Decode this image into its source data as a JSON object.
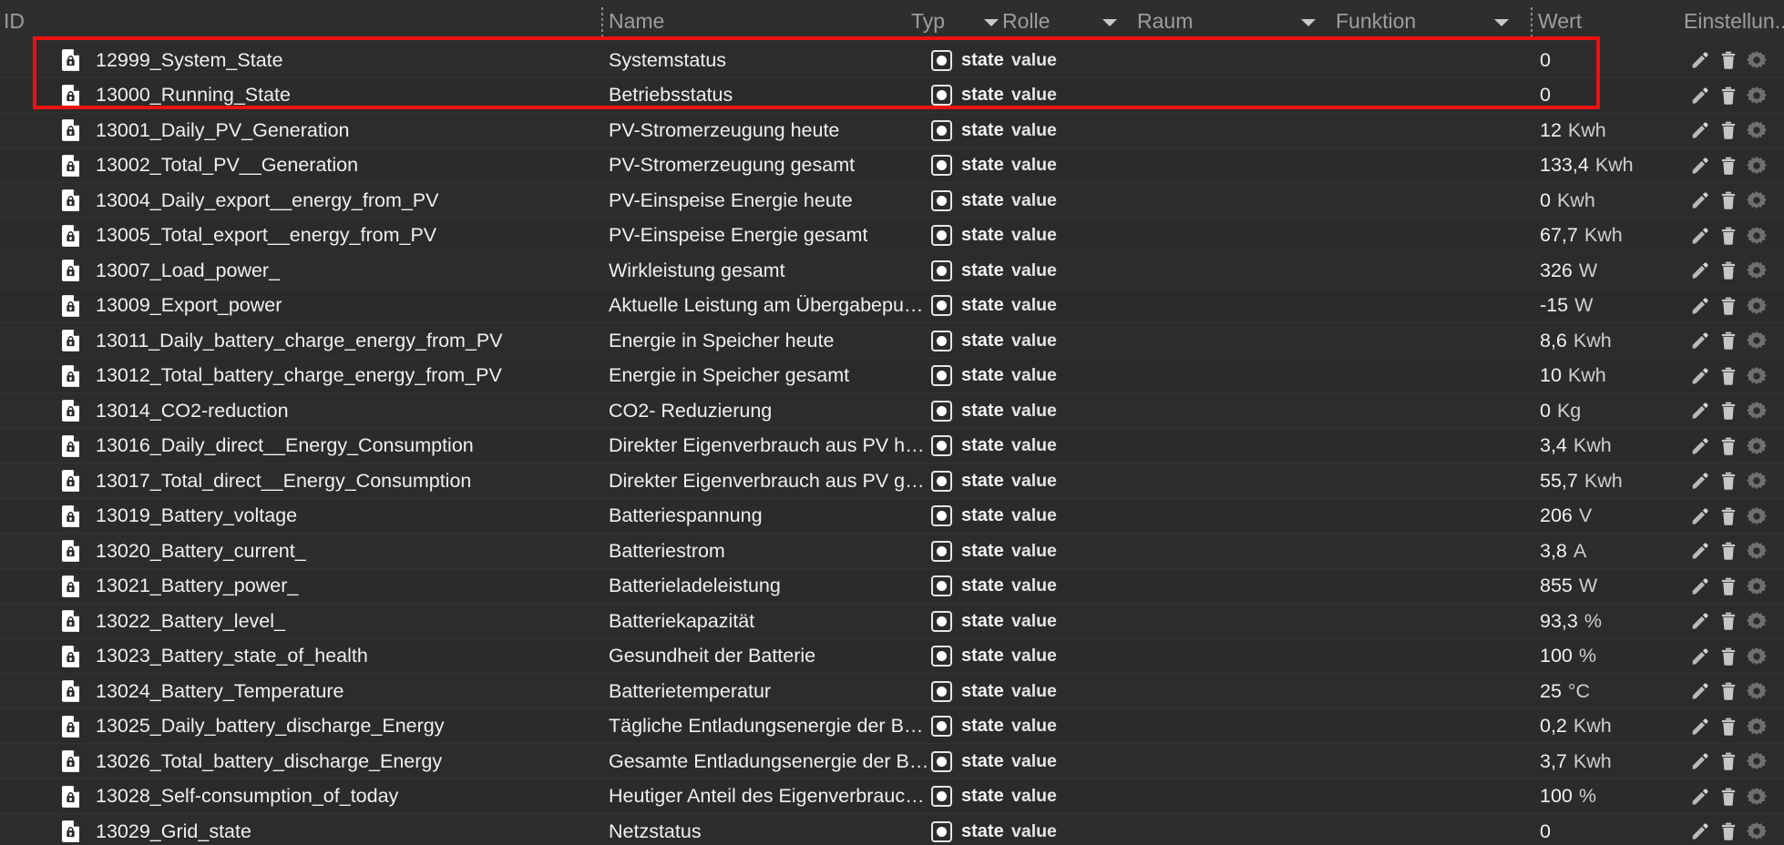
{
  "table": {
    "columns": [
      {
        "key": "id",
        "label": "ID",
        "has_filter": false,
        "has_caret": false
      },
      {
        "key": "name",
        "label": "Name",
        "has_filter": false,
        "has_caret": false
      },
      {
        "key": "typ",
        "label": "Typ",
        "has_filter": true,
        "has_caret": true
      },
      {
        "key": "rolle",
        "label": "Rolle",
        "has_filter": true,
        "has_caret": true
      },
      {
        "key": "raum",
        "label": "Raum",
        "has_filter": true,
        "has_caret": true
      },
      {
        "key": "funktion",
        "label": "Funktion",
        "has_filter": true,
        "has_caret": true
      },
      {
        "key": "wert",
        "label": "Wert",
        "has_filter": false,
        "has_caret": false
      },
      {
        "key": "settings",
        "label": "Einstellun...",
        "has_filter": true,
        "has_caret": false
      }
    ],
    "row_actions": [
      {
        "icon": "pencil-icon",
        "title": "Bearbeiten"
      },
      {
        "icon": "trash-icon",
        "title": "Löschen"
      },
      {
        "icon": "gear-icon",
        "title": "Einstellungen"
      }
    ],
    "rows": [
      {
        "id": "12999_System_State",
        "name": "Systemstatus",
        "typ": "state",
        "rolle": "value",
        "raum": "",
        "funktion": "",
        "wert_num": "0",
        "wert_unit": "",
        "highlighted": true
      },
      {
        "id": "13000_Running_State",
        "name": "Betriebsstatus",
        "typ": "state",
        "rolle": "value",
        "raum": "",
        "funktion": "",
        "wert_num": "0",
        "wert_unit": "",
        "highlighted": true
      },
      {
        "id": "13001_Daily_PV_Generation",
        "name": "PV-Stromerzeugung heute",
        "typ": "state",
        "rolle": "value",
        "raum": "",
        "funktion": "",
        "wert_num": "12",
        "wert_unit": "Kwh",
        "highlighted": false
      },
      {
        "id": "13002_Total_PV__Generation",
        "name": "PV-Stromerzeugung gesamt",
        "typ": "state",
        "rolle": "value",
        "raum": "",
        "funktion": "",
        "wert_num": "133,4",
        "wert_unit": "Kwh",
        "highlighted": false
      },
      {
        "id": "13004_Daily_export__energy_from_PV",
        "name": "PV-Einspeise Energie heute",
        "typ": "state",
        "rolle": "value",
        "raum": "",
        "funktion": "",
        "wert_num": "0",
        "wert_unit": "Kwh",
        "highlighted": false
      },
      {
        "id": "13005_Total_export__energy_from_PV",
        "name": "PV-Einspeise Energie gesamt",
        "typ": "state",
        "rolle": "value",
        "raum": "",
        "funktion": "",
        "wert_num": "67,7",
        "wert_unit": "Kwh",
        "highlighted": false
      },
      {
        "id": "13007_Load_power_",
        "name": "Wirkleistung gesamt",
        "typ": "state",
        "rolle": "value",
        "raum": "",
        "funktion": "",
        "wert_num": "326",
        "wert_unit": "W",
        "highlighted": false
      },
      {
        "id": "13009_Export_power",
        "name": "Aktuelle Leistung am Übergabepunkt des Ve…",
        "typ": "state",
        "rolle": "value",
        "raum": "",
        "funktion": "",
        "wert_num": "-15",
        "wert_unit": "W",
        "highlighted": false
      },
      {
        "id": "13011_Daily_battery_charge_energy_from_PV",
        "name": "Energie in Speicher heute",
        "typ": "state",
        "rolle": "value",
        "raum": "",
        "funktion": "",
        "wert_num": "8,6",
        "wert_unit": "Kwh",
        "highlighted": false
      },
      {
        "id": "13012_Total_battery_charge_energy_from_PV",
        "name": "Energie in Speicher gesamt",
        "typ": "state",
        "rolle": "value",
        "raum": "",
        "funktion": "",
        "wert_num": "10",
        "wert_unit": "Kwh",
        "highlighted": false
      },
      {
        "id": "13014_CO2-reduction",
        "name": "CO2- Reduzierung",
        "typ": "state",
        "rolle": "value",
        "raum": "",
        "funktion": "",
        "wert_num": "0",
        "wert_unit": "Kg",
        "highlighted": false
      },
      {
        "id": "13016_Daily_direct__Energy_Consumption",
        "name": "Direkter Eigenverbrauch aus PV heute",
        "typ": "state",
        "rolle": "value",
        "raum": "",
        "funktion": "",
        "wert_num": "3,4",
        "wert_unit": "Kwh",
        "highlighted": false
      },
      {
        "id": "13017_Total_direct__Energy_Consumption",
        "name": "Direkter Eigenverbrauch aus PV gesamt",
        "typ": "state",
        "rolle": "value",
        "raum": "",
        "funktion": "",
        "wert_num": "55,7",
        "wert_unit": "Kwh",
        "highlighted": false
      },
      {
        "id": "13019_Battery_voltage",
        "name": "Batteriespannung",
        "typ": "state",
        "rolle": "value",
        "raum": "",
        "funktion": "",
        "wert_num": "206",
        "wert_unit": "V",
        "highlighted": false
      },
      {
        "id": "13020_Battery_current_",
        "name": "Batteriestrom",
        "typ": "state",
        "rolle": "value",
        "raum": "",
        "funktion": "",
        "wert_num": "3,8",
        "wert_unit": "A",
        "highlighted": false
      },
      {
        "id": "13021_Battery_power_",
        "name": "Batterieladeleistung",
        "typ": "state",
        "rolle": "value",
        "raum": "",
        "funktion": "",
        "wert_num": "855",
        "wert_unit": "W",
        "highlighted": false
      },
      {
        "id": "13022_Battery_level_",
        "name": "Batteriekapazität",
        "typ": "state",
        "rolle": "value",
        "raum": "",
        "funktion": "",
        "wert_num": "93,3",
        "wert_unit": "%",
        "highlighted": false
      },
      {
        "id": "13023_Battery_state_of_health",
        "name": "Gesundheit der Batterie",
        "typ": "state",
        "rolle": "value",
        "raum": "",
        "funktion": "",
        "wert_num": "100",
        "wert_unit": "%",
        "highlighted": false
      },
      {
        "id": "13024_Battery_Temperature",
        "name": "Batterietemperatur",
        "typ": "state",
        "rolle": "value",
        "raum": "",
        "funktion": "",
        "wert_num": "25",
        "wert_unit": "°C",
        "highlighted": false
      },
      {
        "id": "13025_Daily_battery_discharge_Energy",
        "name": "Tägliche Entladungsenergie der Batterie",
        "typ": "state",
        "rolle": "value",
        "raum": "",
        "funktion": "",
        "wert_num": "0,2",
        "wert_unit": "Kwh",
        "highlighted": false
      },
      {
        "id": "13026_Total_battery_discharge_Energy",
        "name": "Gesamte Entladungsenergie der Batterie",
        "typ": "state",
        "rolle": "value",
        "raum": "",
        "funktion": "",
        "wert_num": "3,7",
        "wert_unit": "Kwh",
        "highlighted": false
      },
      {
        "id": "13028_Self-consumption_of_today",
        "name": "Heutiger Anteil des Eigenverbrauches",
        "typ": "state",
        "rolle": "value",
        "raum": "",
        "funktion": "",
        "wert_num": "100",
        "wert_unit": "%",
        "highlighted": false
      },
      {
        "id": "13029_Grid_state",
        "name": "Netzstatus",
        "typ": "state",
        "rolle": "value",
        "raum": "",
        "funktion": "",
        "wert_num": "0",
        "wert_unit": "",
        "highlighted": false
      }
    ]
  },
  "annotation": {
    "highlight_color": "#ee1111",
    "highlight_rows": [
      "12999_System_State",
      "13000_Running_State"
    ]
  },
  "colors": {
    "background": "#2b2b2b",
    "header_background": "#2e2e2e",
    "text": "#f0f0f0",
    "muted_text": "#9a9a9a",
    "accent": "#ee1111"
  }
}
